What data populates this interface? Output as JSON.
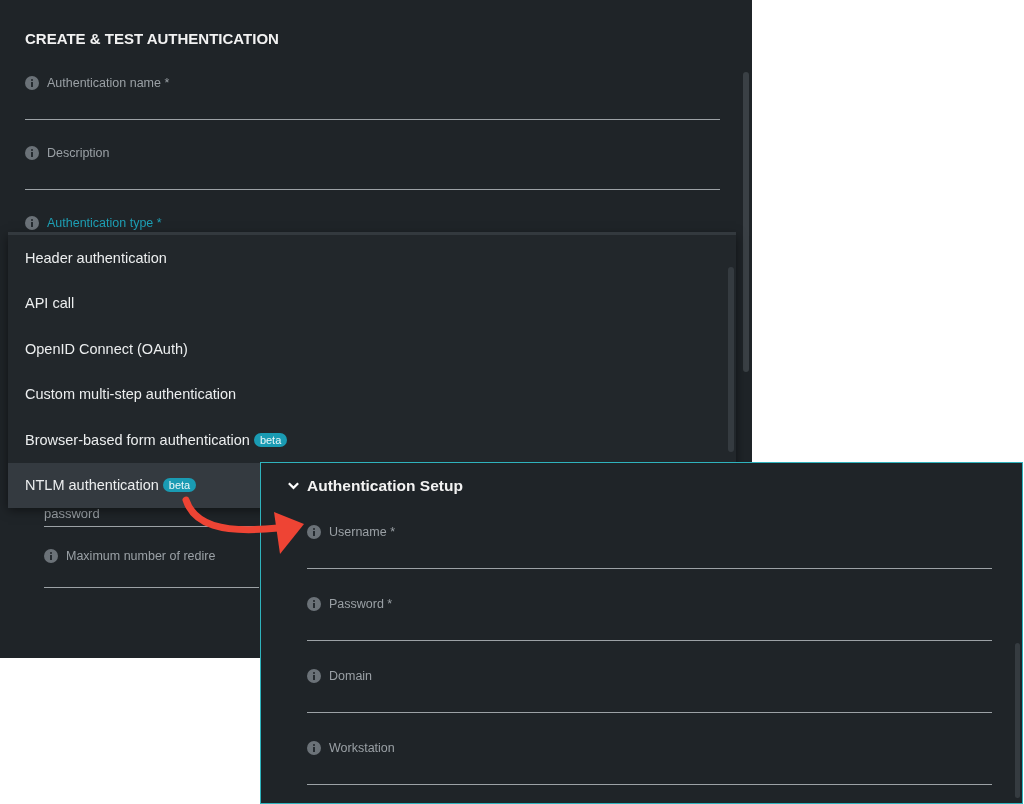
{
  "form": {
    "title": "CREATE & TEST AUTHENTICATION",
    "fields": [
      {
        "label": "Authentication name *",
        "focused": false
      },
      {
        "label": "Description",
        "focused": false
      },
      {
        "label": "Authentication type *",
        "focused": true
      }
    ],
    "nested_value": "password",
    "nested_label": "Maximum number of redire"
  },
  "dropdown": {
    "options": [
      {
        "label": "Header authentication",
        "selected": false
      },
      {
        "label": "API call",
        "selected": false
      },
      {
        "label": "OpenID Connect (OAuth)",
        "selected": false
      },
      {
        "label": "Custom multi-step authentication",
        "selected": false
      },
      {
        "label": "Browser-based form authentication",
        "badge": "beta",
        "selected": false
      },
      {
        "label": "NTLM authentication",
        "badge": "beta",
        "selected": true
      }
    ]
  },
  "setup": {
    "title": "Authentication Setup",
    "expanded": true,
    "fields": [
      {
        "label": "Username *"
      },
      {
        "label": "Password *"
      },
      {
        "label": "Domain"
      },
      {
        "label": "Workstation"
      }
    ]
  }
}
